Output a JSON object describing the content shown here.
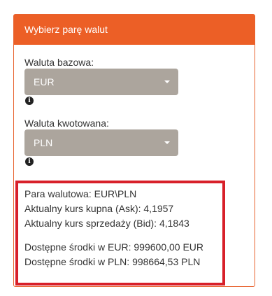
{
  "panel": {
    "title": "Wybierz parę walut"
  },
  "base_currency": {
    "label": "Waluta bazowa:",
    "value": "EUR",
    "info_icon": "info-circle-icon"
  },
  "quote_currency": {
    "label": "Waluta kwotowana:",
    "value": "PLN",
    "info_icon": "info-circle-icon"
  },
  "summary": {
    "pair": "Para walutowa: EUR\\PLN",
    "ask": "Aktualny kurs kupna (Ask): 4,1957",
    "bid": "Aktualny kurs sprzedaży (Bid): 4,1843",
    "funds_eur": "Dostępne środki w EUR: 999600,00 EUR",
    "funds_pln": "Dostępne środki w PLN: 998664,53 PLN"
  },
  "colors": {
    "header": "#ec5f26",
    "select_bg": "#aca59d",
    "highlight_border": "#d8202a"
  }
}
